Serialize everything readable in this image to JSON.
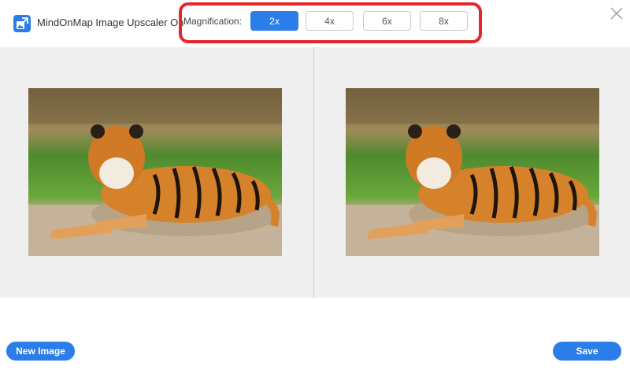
{
  "app": {
    "title": "MindOnMap Image Upscaler Online",
    "icon": "image-upscale-icon",
    "accent_color": "#2b7de9"
  },
  "magnification": {
    "label": "Magnification:",
    "options": [
      "2x",
      "4x",
      "6x",
      "8x"
    ],
    "selected": "2x",
    "highlight_color": "#e6262b"
  },
  "preview": {
    "left_image": "tiger-photo",
    "right_image": "tiger-photo"
  },
  "footer": {
    "new_image_label": "New Image",
    "save_label": "Save"
  }
}
